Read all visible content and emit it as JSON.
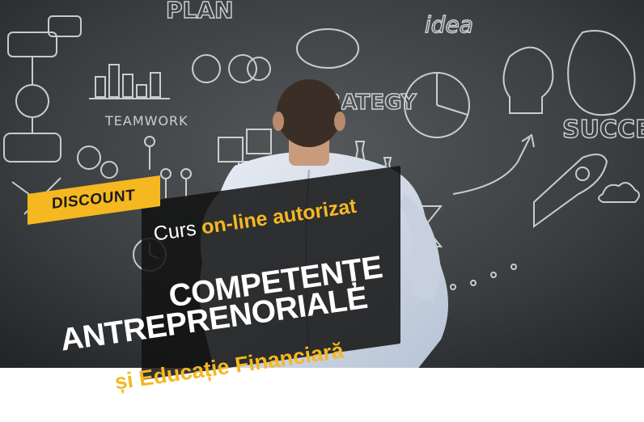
{
  "banner": {
    "badge": "DISCOUNT",
    "subtitle_plain": "Curs",
    "subtitle_accent": "on-line autorizat",
    "title_line1": "COMPETENȚE",
    "title_line2": "ANTREPRENORIALE",
    "title_line3": "și Educație Financiară"
  },
  "board_words": {
    "teamwork": "TEAMWORK",
    "strategy": "STRATEGY",
    "success": "SUCCE",
    "plan": "PLAN",
    "idea": "idea"
  },
  "colors": {
    "accent": "#f5b820",
    "card": "#121212",
    "chalkboard": "#3a3d40",
    "chalk": "#e6e6e6"
  }
}
